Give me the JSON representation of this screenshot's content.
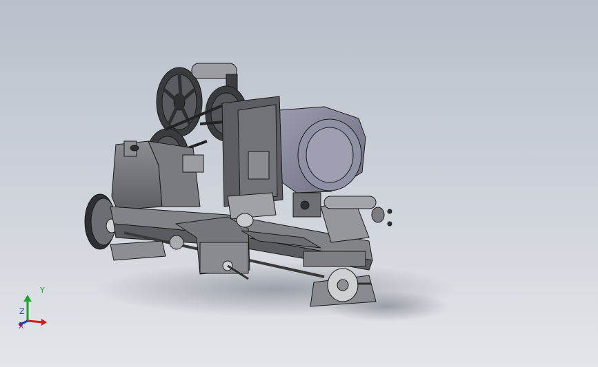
{
  "viewport": {
    "background_top": "#b9c0cb",
    "background_bottom": "#e3e6ea"
  },
  "model": {
    "part_color": "#6f7075",
    "motor_color": "#7d7f92",
    "edge_color": "#1a1a1a",
    "dark_color": "#2e2f33"
  },
  "triad": {
    "x_label": "X",
    "y_label": "Y",
    "z_label": "Z",
    "x_color": "#d11a1a",
    "y_color": "#1fa32a",
    "z_color": "#2233cc"
  }
}
